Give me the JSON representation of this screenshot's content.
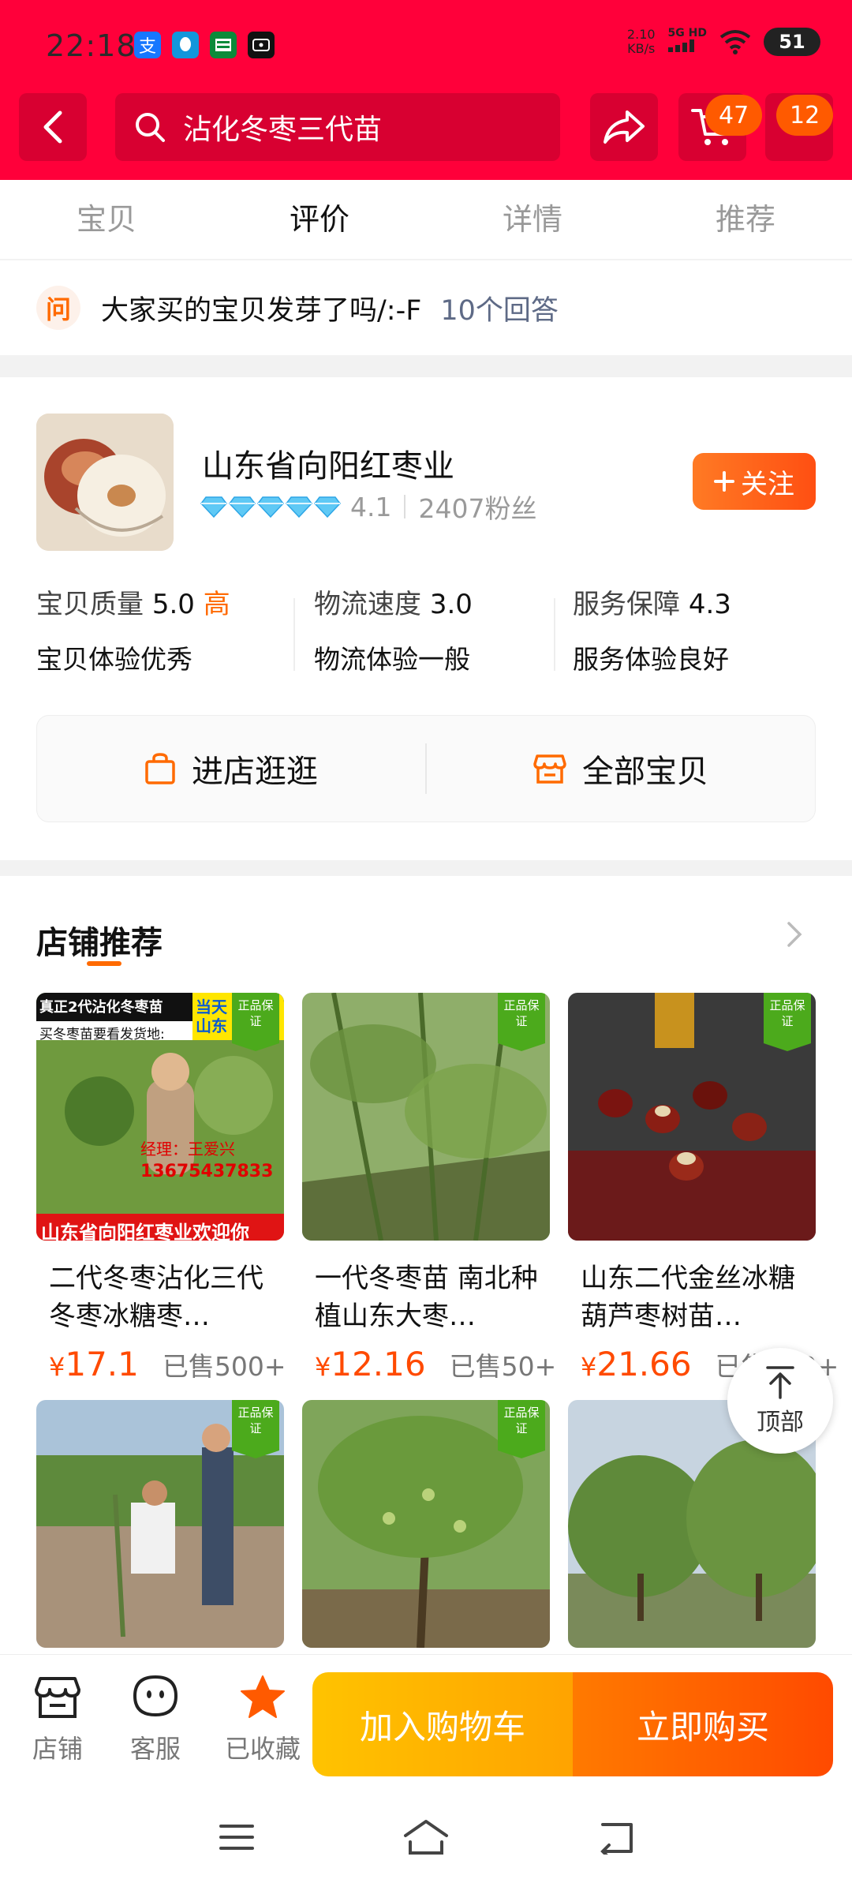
{
  "status_bar": {
    "time": "22:18",
    "net_speed": "2.10",
    "net_unit": "KB/s",
    "signal_label": "5G HD",
    "battery": "51",
    "app_icons": [
      "alipay-icon",
      "qq-icon",
      "post-icon",
      "video-icon"
    ]
  },
  "header": {
    "search_text": "沾化冬枣三代苗",
    "cart_badge": "47",
    "more_badge": "12"
  },
  "tabs": [
    {
      "label": "宝贝",
      "active": false
    },
    {
      "label": "评价",
      "active": true
    },
    {
      "label": "详情",
      "active": false
    },
    {
      "label": "推荐",
      "active": false
    }
  ],
  "qa": {
    "icon_text": "问",
    "question": "大家买的宝贝发芽了吗/:-F",
    "answers": "10个回答"
  },
  "shop": {
    "name": "山东省向阳红枣业",
    "diamonds": 5,
    "score": "4.1",
    "fans": "2407粉丝",
    "follow_label": "关注",
    "metrics": [
      {
        "label": "宝贝质量",
        "value": "5.0",
        "level": "高",
        "desc": "宝贝体验优秀"
      },
      {
        "label": "物流速度",
        "value": "3.0",
        "level": "",
        "desc": "物流体验一般"
      },
      {
        "label": "服务保障",
        "value": "4.3",
        "level": "",
        "desc": "服务体验良好"
      }
    ],
    "enter_store": "进店逛逛",
    "all_items": "全部宝贝"
  },
  "recommend": {
    "title": "店铺推荐",
    "items": [
      {
        "desc": "二代冬枣沾化三代冬枣冰糖枣…",
        "price": "17.1",
        "sold": "已售500+",
        "tag": "正品保证"
      },
      {
        "desc": "一代冬枣苗 南北种植山东大枣…",
        "price": "12.16",
        "sold": "已售50+",
        "tag": "正品保证"
      },
      {
        "desc": "山东二代金丝冰糖葫芦枣树苗…",
        "price": "21.66",
        "sold": "已售100+",
        "tag": "正品保证"
      },
      {
        "desc": "",
        "price": "",
        "sold": "",
        "tag": "正品保证"
      },
      {
        "desc": "",
        "price": "",
        "sold": "",
        "tag": "正品保证"
      },
      {
        "desc": "",
        "price": "",
        "sold": "",
        "tag": ""
      }
    ],
    "banner": {
      "top": "真正2代沾化冬枣苗",
      "mid": "买冬枣苗要看发货地:",
      "side": "当天 山东",
      "manager": "经理：王爱兴",
      "phone": "13675437833",
      "bottom": "山东省向阳红枣业欢迎你"
    },
    "currency": "¥"
  },
  "to_top_label": "顶部",
  "bottom_bar": {
    "store": "店铺",
    "service": "客服",
    "favorite": "已收藏",
    "add_cart": "加入购物车",
    "buy_now": "立即购买"
  },
  "colors": {
    "brand_red": "#ff003a",
    "accent_orange": "#ff6a00",
    "cart_yellow": "#ffb300",
    "buy_orange": "#ff5a00"
  }
}
